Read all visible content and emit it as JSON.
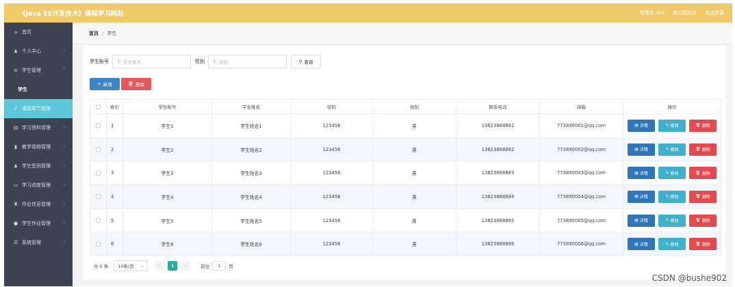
{
  "app": {
    "title": "《Java EE开发技术》课程学习网站",
    "user_label": "管理员 abo",
    "back_label": "退出到前台",
    "logout_label": "退出登录"
  },
  "sidebar": {
    "items": [
      {
        "label": "首页",
        "icon": "home-icon",
        "glyph": "⌂"
      },
      {
        "label": "个人中心",
        "icon": "user-icon",
        "glyph": "♟"
      },
      {
        "label": "学生管理",
        "icon": "list-icon",
        "glyph": "≡"
      },
      {
        "label": "学生",
        "icon": "",
        "glyph": ""
      },
      {
        "label": "课程章节管理",
        "icon": "mic-icon",
        "glyph": "♪"
      },
      {
        "label": "学习资料管理",
        "icon": "file-icon",
        "glyph": "▤"
      },
      {
        "label": "教学视频管理",
        "icon": "bar-chart-icon",
        "glyph": "▮"
      },
      {
        "label": "学生签到管理",
        "icon": "person-icon",
        "glyph": "♟"
      },
      {
        "label": "学习进度管理",
        "icon": "progress-icon",
        "glyph": "▭"
      },
      {
        "label": "作业信息管理",
        "icon": "trophy-icon",
        "glyph": "♜"
      },
      {
        "label": "学生作业管理",
        "icon": "location-icon",
        "glyph": "●"
      },
      {
        "label": "系统管理",
        "icon": "settings-icon",
        "glyph": "☰"
      }
    ]
  },
  "breadcrumb": {
    "home": "首页",
    "sep": "/",
    "current": "学生"
  },
  "search": {
    "account_label": "学生账号",
    "account_placeholder": "学生账号",
    "gender_label": "性别",
    "gender_placeholder": "性别",
    "query_label": "查询"
  },
  "actions": {
    "add_label": "新增",
    "delete_label": "删除"
  },
  "table": {
    "headers": [
      "",
      "索引",
      "学生账号",
      "学生姓名",
      "密码",
      "性别",
      "联系电话",
      "邮箱",
      "操作"
    ],
    "rows": [
      {
        "idx": "1",
        "account": "学生1",
        "name": "学生姓名1",
        "password": "123456",
        "gender": "男",
        "phone": "13823888881",
        "email": "773890001@qq.com"
      },
      {
        "idx": "2",
        "account": "学生2",
        "name": "学生姓名2",
        "password": "123456",
        "gender": "男",
        "phone": "13823888882",
        "email": "773890002@qq.com"
      },
      {
        "idx": "3",
        "account": "学生3",
        "name": "学生姓名3",
        "password": "123456",
        "gender": "男",
        "phone": "13823888883",
        "email": "773890003@qq.com"
      },
      {
        "idx": "4",
        "account": "学生4",
        "name": "学生姓名4",
        "password": "123456",
        "gender": "男",
        "phone": "13823888884",
        "email": "773890004@qq.com"
      },
      {
        "idx": "5",
        "account": "学生5",
        "name": "学生姓名5",
        "password": "123456",
        "gender": "男",
        "phone": "13823888885",
        "email": "773890005@qq.com"
      },
      {
        "idx": "6",
        "account": "学生6",
        "name": "学生姓名6",
        "password": "123456",
        "gender": "男",
        "phone": "13823888886",
        "email": "773890006@qq.com"
      }
    ],
    "op_detail": "详情",
    "op_edit": "修改",
    "op_delete": "删除"
  },
  "pagination": {
    "total": "共 6 条",
    "page_size": "10条/页",
    "current_page": "1",
    "goto_prefix": "前往",
    "goto_value": "1",
    "goto_suffix": "页"
  },
  "watermark": "CSDN @bushe902",
  "colors": {
    "topbar": "#f0c96a",
    "sidebar": "#3d4350",
    "active_menu": "#5cc7d6",
    "detail": "#2f76b8",
    "edit": "#41b0cc",
    "delete": "#e24a4d",
    "page_active": "#1fb19e"
  }
}
